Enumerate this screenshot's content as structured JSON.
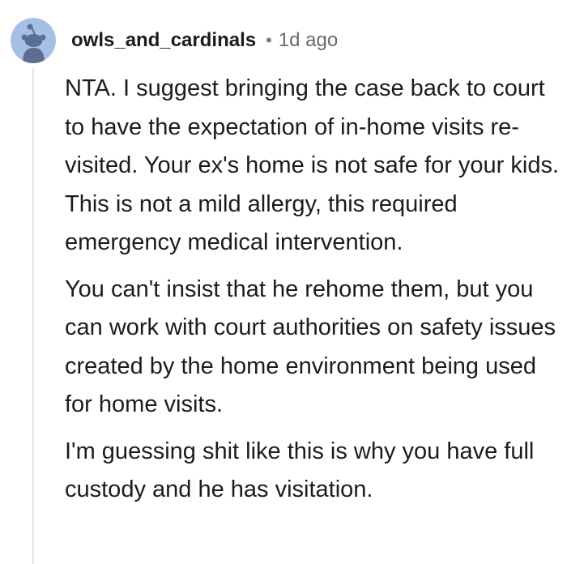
{
  "comment": {
    "author": "owls_and_cardinals",
    "separator": "•",
    "timestamp": "1d ago",
    "paragraphs": [
      "NTA. I suggest bringing the case back to court to have the expectation of in-home visits re-visited. Your ex's home is not safe for your kids. This is not a mild allergy, this required emergency medical intervention.",
      "You can't insist that he rehome them, but you can work with court authorities on safety issues created by the home environment being used for home visits.",
      "I'm guessing shit like this is why you have full custody and he has visitation."
    ]
  },
  "avatar": {
    "icon": "snoo-avatar-icon",
    "background_color": "#a5bfe6",
    "figure_color": "#5c6f93"
  },
  "colors": {
    "text": "#1c1c1c",
    "meta": "#6a6a6a",
    "thread_line": "#e4e6e8"
  }
}
